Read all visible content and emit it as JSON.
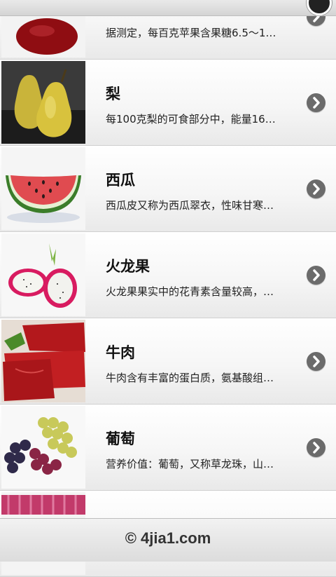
{
  "header": {
    "title": ""
  },
  "items": [
    {
      "title": "",
      "desc": "据测定，每百克苹果含果糖6.5～1…",
      "image": "apple-image"
    },
    {
      "title": "梨",
      "desc": "每100克梨的可食部分中，能量16…",
      "image": "pear-image"
    },
    {
      "title": "西瓜",
      "desc": "西瓜皮又称为西瓜翠衣，性味甘寒…",
      "image": "watermelon-image"
    },
    {
      "title": "火龙果",
      "desc": "火龙果果实中的花青素含量较高，…",
      "image": "dragonfruit-image"
    },
    {
      "title": "牛肉",
      "desc": "牛肉含有丰富的蛋白质，氨基酸组…",
      "image": "beef-image"
    },
    {
      "title": "葡萄",
      "desc": "营养价值：葡萄，又称草龙珠，山…",
      "image": "grape-image"
    },
    {
      "title": "",
      "desc": "",
      "image": "partial-image"
    }
  ],
  "footer": {
    "copyright": "© 4jia1.com"
  },
  "icons": {
    "row_arrow": "chevron-right-icon"
  },
  "colors": {
    "chevron": "#6b6b6b",
    "divider": "#d0d0d0"
  }
}
